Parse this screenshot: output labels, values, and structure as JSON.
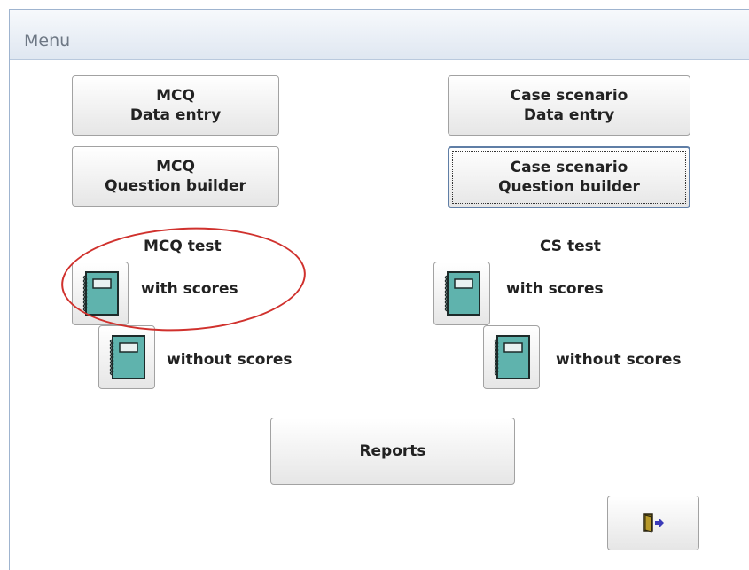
{
  "window": {
    "title": "Menu"
  },
  "buttons": {
    "mcq_data_entry": {
      "line1": "MCQ",
      "line2": "Data entry"
    },
    "mcq_question_builder": {
      "line1": "MCQ",
      "line2": "Question builder"
    },
    "cs_data_entry": {
      "line1": "Case scenario",
      "line2": "Data entry"
    },
    "cs_question_builder": {
      "line1": "Case scenario",
      "line2": "Question builder"
    },
    "reports": "Reports"
  },
  "mcq_test": {
    "heading": "MCQ test",
    "with_scores": "with scores",
    "without_scores": "without scores"
  },
  "cs_test": {
    "heading": "CS test",
    "with_scores": "with scores",
    "without_scores": "without scores"
  },
  "icons": {
    "notebook": "notebook-icon",
    "exit": "exit-door-icon"
  },
  "colors": {
    "annotation_circle": "#d0312d",
    "notebook_fill": "#5fb3ad",
    "titlebar": "#dfe7f1"
  }
}
